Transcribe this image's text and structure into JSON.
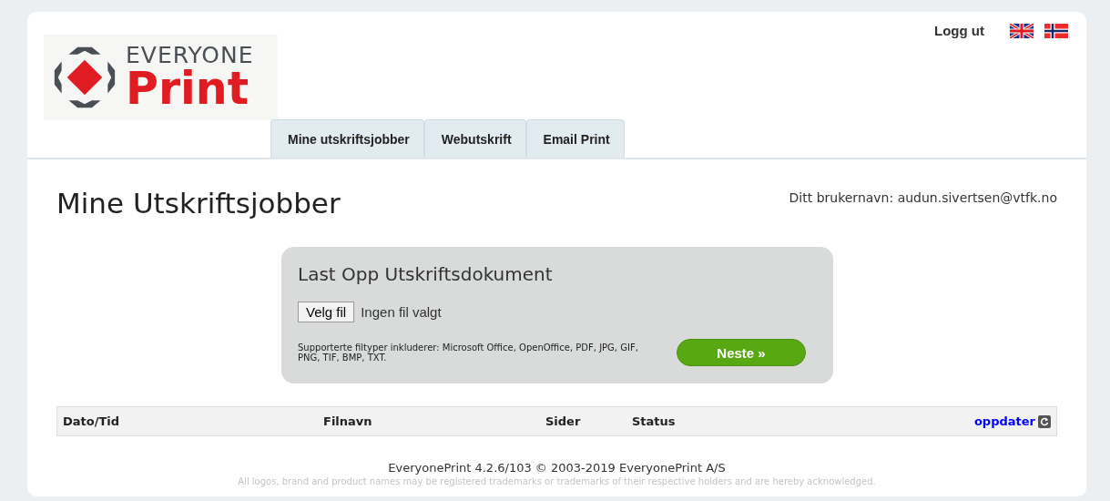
{
  "logo": {
    "brand_top": "EVERYONE",
    "brand_bottom": "Print"
  },
  "header": {
    "logout": "Logg ut"
  },
  "tabs": [
    {
      "label": "Mine utskriftsjobber",
      "selected": false
    },
    {
      "label": "Webutskrift",
      "selected": false
    },
    {
      "label": "Email Print",
      "selected": false
    }
  ],
  "page_title": "Mine Utskriftsjobber",
  "username_label": "Ditt brukernavn: audun.sivertsen@vtfk.no",
  "upload": {
    "title": "Last Opp Utskriftsdokument",
    "choose_button": "Velg fil",
    "file_status": "Ingen fil valgt",
    "supported": "Supporterte filtyper inkluderer: Microsoft Office, OpenOffice, PDF, JPG, GIF, PNG, TIF, BMP, TXT.",
    "next_button": "Neste »"
  },
  "table": {
    "columns": [
      "Dato/Tid",
      "Filnavn",
      "Sider",
      "Status"
    ],
    "refresh": "oppdater"
  },
  "footer": {
    "version": "EveryonePrint 4.2.6/103 © 2003-2019 EveryonePrint A/S",
    "disclaimer": "All logos, brand and product names may be registered trademarks or trademarks of their respective holders and are hereby acknowledged."
  }
}
